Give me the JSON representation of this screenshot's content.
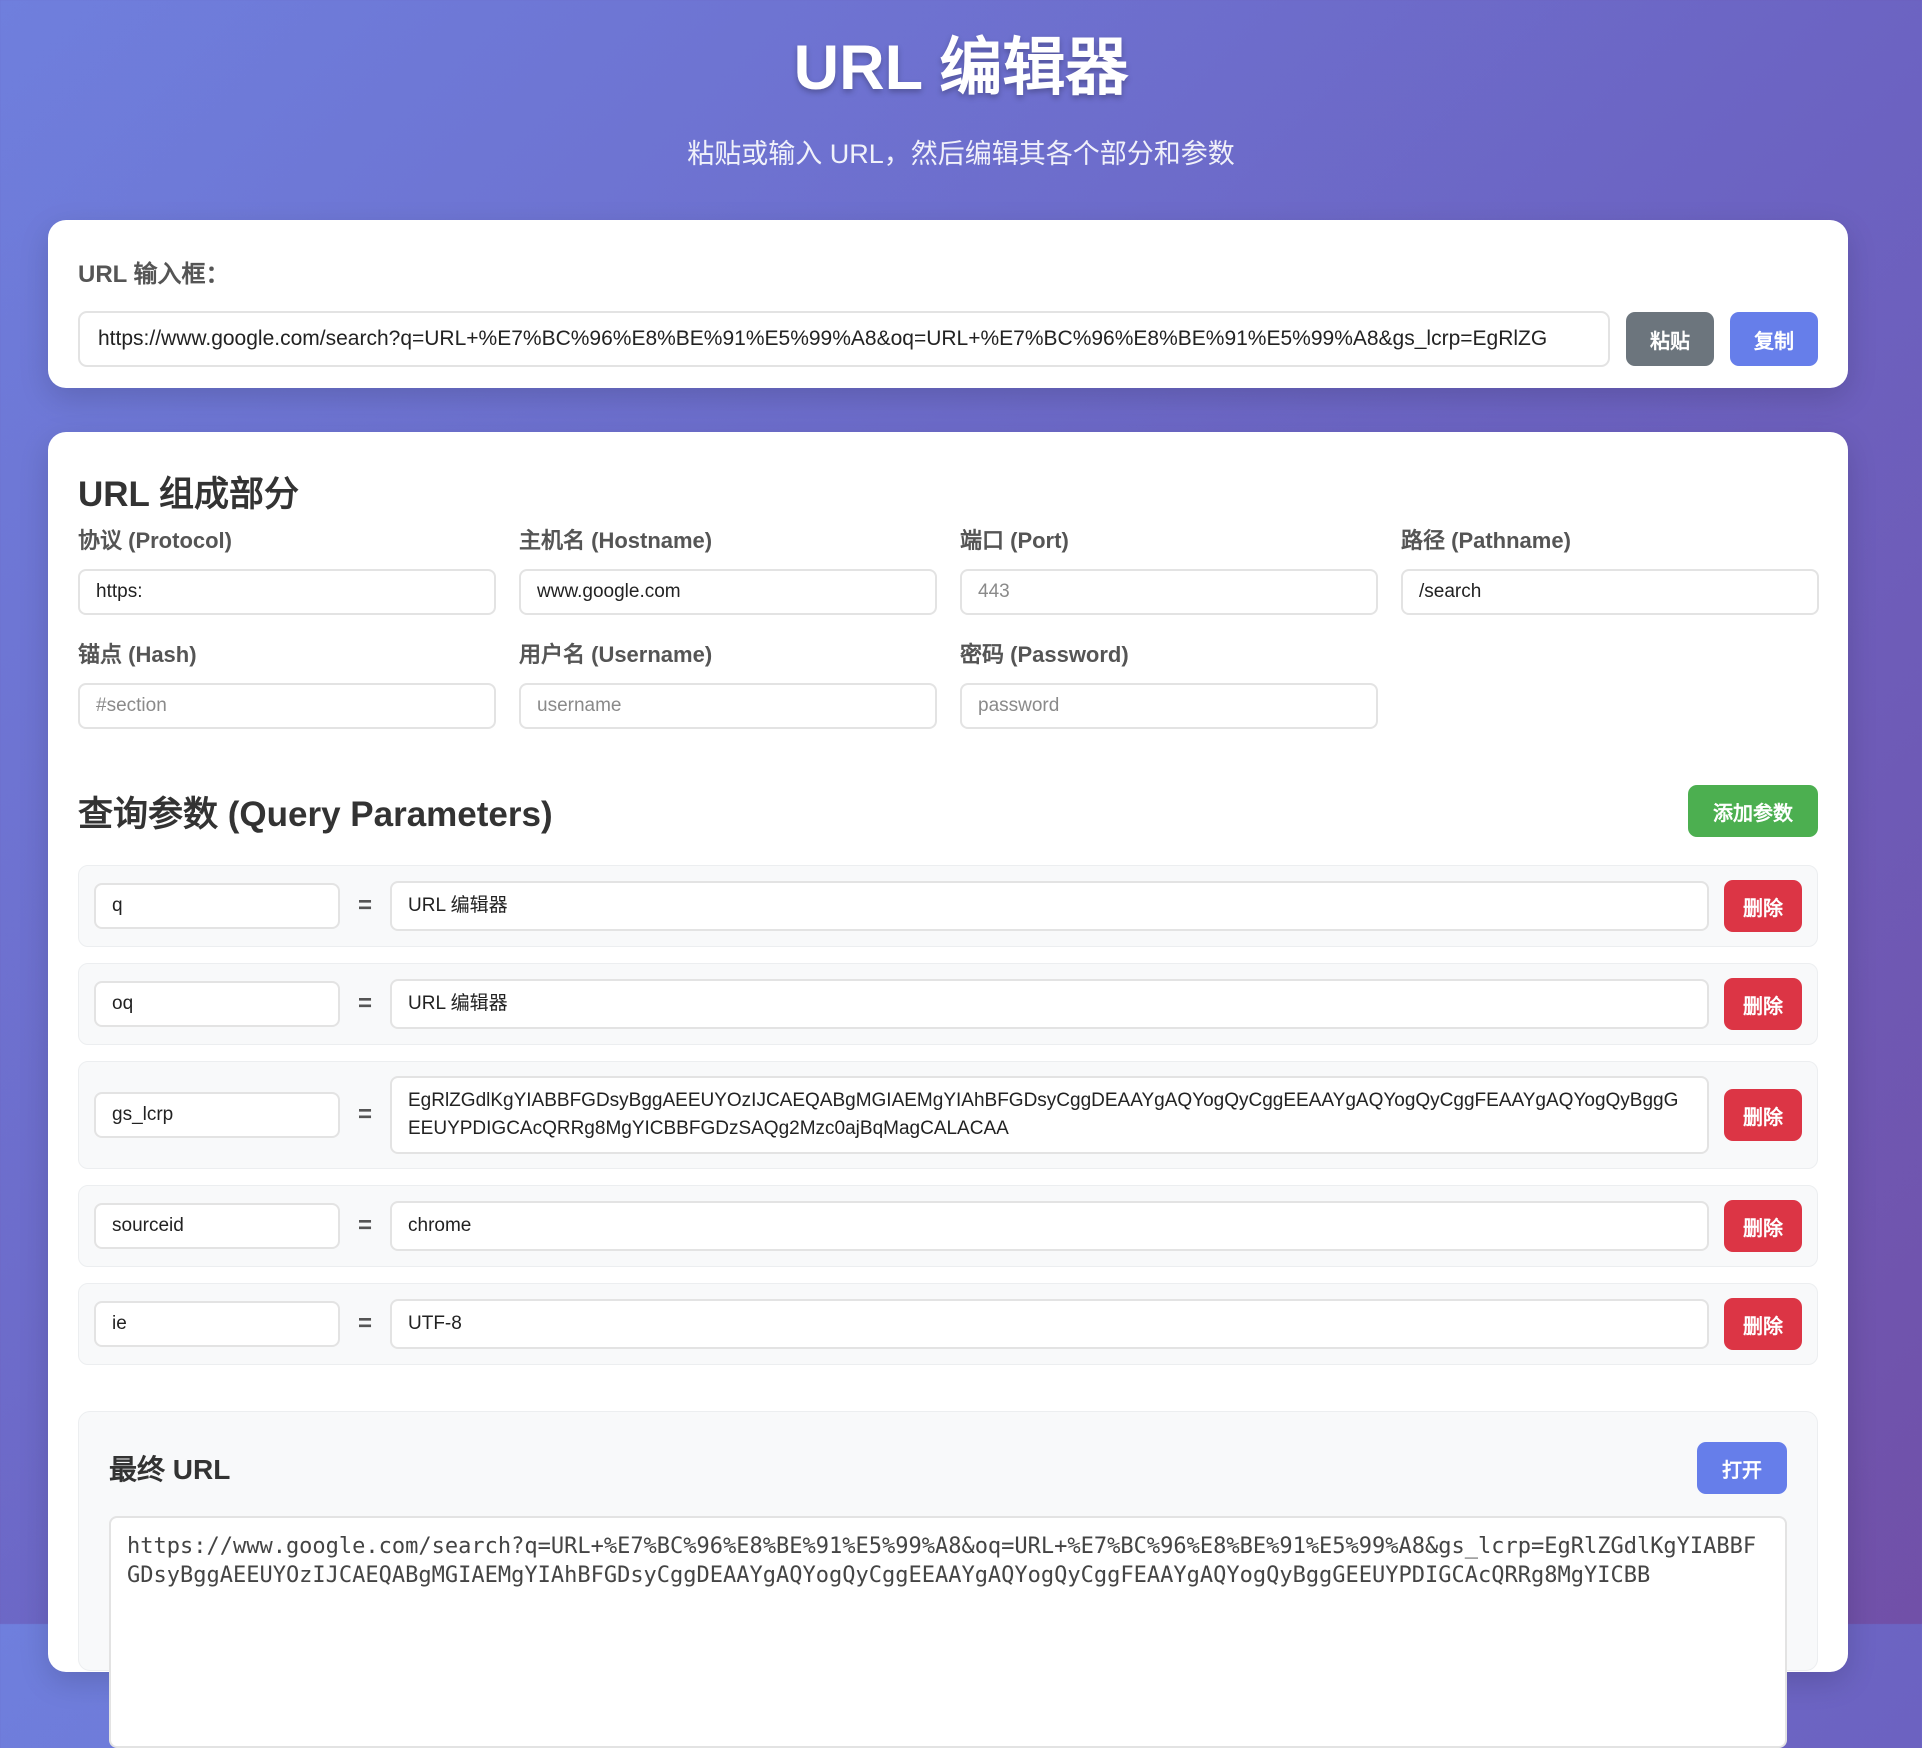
{
  "header": {
    "title": "URL 编辑器",
    "subtitle": "粘贴或输入 URL，然后编辑其各个部分和参数"
  },
  "input_card": {
    "label": "URL 输入框：",
    "url_value": "https://www.google.com/search?q=URL+%E7%BC%96%E8%BE%91%E5%99%A8&oq=URL+%E7%BC%96%E8%BE%91%E5%99%A8&gs_lcrp=EgRlZG",
    "paste_label": "粘贴",
    "copy_label": "复制"
  },
  "components": {
    "title": "URL 组成部分",
    "protocol": {
      "label": "协议 (Protocol)",
      "value": "https:"
    },
    "hostname": {
      "label": "主机名 (Hostname)",
      "value": "www.google.com"
    },
    "port": {
      "label": "端口 (Port)",
      "placeholder": "443"
    },
    "pathname": {
      "label": "路径 (Pathname)",
      "value": "/search"
    },
    "hash": {
      "label": "锚点 (Hash)",
      "placeholder": "#section"
    },
    "username": {
      "label": "用户名 (Username)",
      "placeholder": "username"
    },
    "password": {
      "label": "密码 (Password)",
      "placeholder": "password"
    }
  },
  "query": {
    "title": "查询参数 (Query Parameters)",
    "add_label": "添加参数",
    "equals": "=",
    "delete_label": "删除",
    "params": [
      {
        "key": "q",
        "value": "URL 编辑器"
      },
      {
        "key": "oq",
        "value": "URL 编辑器"
      },
      {
        "key": "gs_lcrp",
        "value": "EgRlZGdlKgYIABBFGDsyBggAEEUYOzIJCAEQABgMGIAEMgYIAhBFGDsyCggDEAAYgAQYogQyCggEEAAYgAQYogQyCggFEAAYgAQYogQyBggGEEUYPDIGCAcQRRg8MgYICBBFGDzSAQg2Mzc0ajBqMagCALACAA"
      },
      {
        "key": "sourceid",
        "value": "chrome"
      },
      {
        "key": "ie",
        "value": "UTF-8"
      }
    ]
  },
  "final": {
    "title": "最终 URL",
    "open_label": "打开",
    "url": "https://www.google.com/search?q=URL+%E7%BC%96%E8%BE%91%E5%99%A8&oq=URL+%E7%BC%96%E8%BE%91%E5%99%A8&gs_lcrp=EgRlZGdlKgYIABBFGDsyBggAEEUYOzIJCAEQABgMGIAEMgYIAhBFGDsyCggDEAAYgAQYogQyCggEEAAYgAQYogQyCggFEAAYgAQYogQyBggGEEUYPDIGCAcQRRg8MgYICBB"
  }
}
